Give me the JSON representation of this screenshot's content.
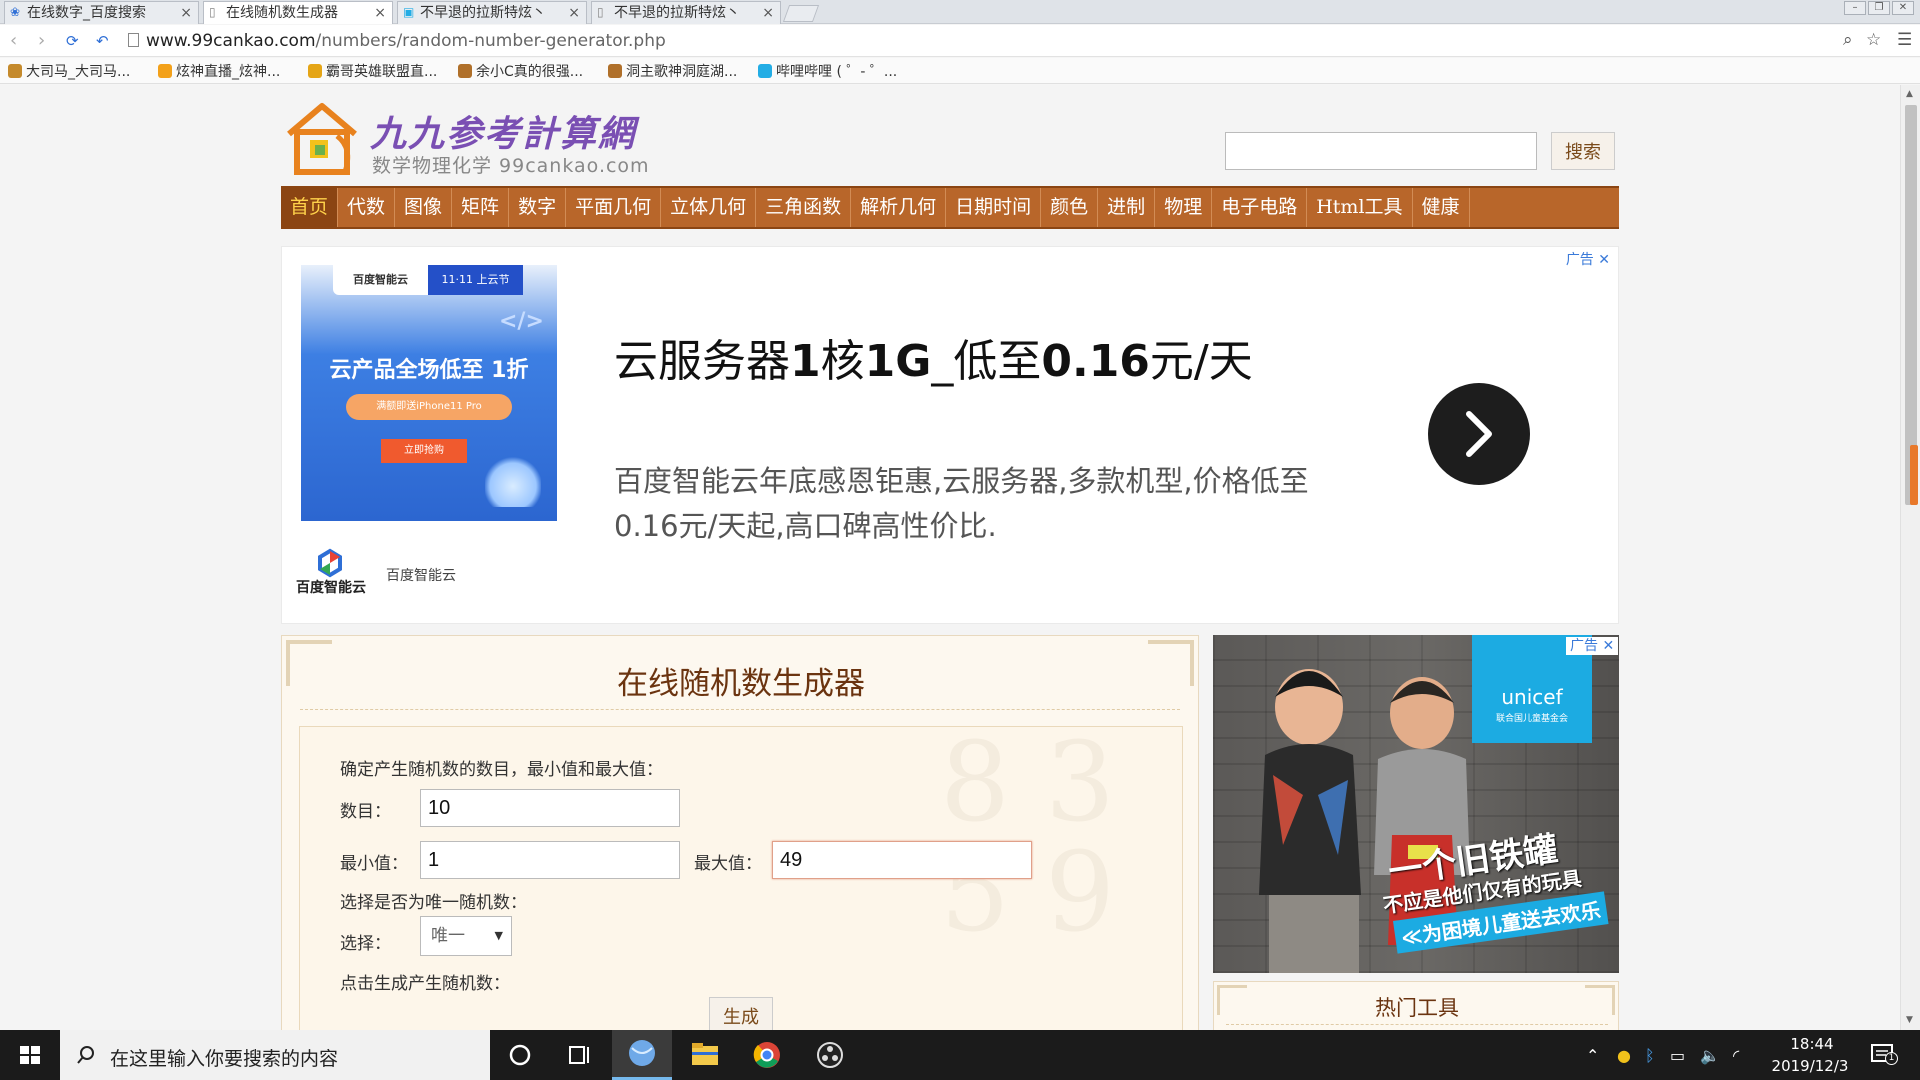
{
  "browser": {
    "tabs": [
      {
        "title": "在线数字_百度搜索",
        "active": false
      },
      {
        "title": "在线随机数生成器",
        "active": true
      },
      {
        "title": "不早退的拉斯特炫丶",
        "active": false
      },
      {
        "title": "不早退的拉斯特炫丶",
        "active": false
      }
    ],
    "close_glyph": "×",
    "url_host": "www.99cankao.com",
    "url_path": "/numbers/random-number-generator.php",
    "bookmarks": [
      {
        "label": "大司马_大司马...",
        "icon_color": "#c58a2c"
      },
      {
        "label": "炫神直播_炫神...",
        "icon_color": "#f3a11a"
      },
      {
        "label": "霸哥英雄联盟直...",
        "icon_color": "#e5a516"
      },
      {
        "label": "余小C真的很强...",
        "icon_color": "#b0702a"
      },
      {
        "label": "洞主歌神洞庭湖...",
        "icon_color": "#b0702a"
      },
      {
        "label": "哔哩哔哩 ( ゜- ゜...",
        "icon_color": "#23ade5"
      }
    ]
  },
  "site": {
    "logo_title": "九九参考計算網",
    "logo_sub": "数学物理化学 99cankao.com",
    "search_placeholder": "",
    "search_button": "搜索",
    "nav": [
      "首页",
      "代数",
      "图像",
      "矩阵",
      "数字",
      "平面几何",
      "立体几何",
      "三角函数",
      "解析几何",
      "日期时间",
      "颜色",
      "进制",
      "物理",
      "电子电路",
      "Html工具",
      "健康"
    ],
    "nav_active_index": 0,
    "brand_color": "#b8662a"
  },
  "ad": {
    "badge": "广告",
    "close_glyph": "✕",
    "image_top_left": "百度智能云",
    "image_top_right": "11·11 上云节",
    "image_headline": "云产品全场低至 1折",
    "image_pill": "满额即送iPhone11 Pro",
    "image_cta": "立即抢购",
    "image_code": "</>",
    "title_parts": [
      "云服务器",
      "1",
      "核",
      "1G",
      "_低至",
      "0.16",
      "元/天"
    ],
    "description": "百度智能云年底感恩钜惠,云服务器,多款机型,价格低至0.16元/天起,高口碑高性价比.",
    "brand_logo_text": "百度智能云",
    "brand_name": "百度智能云"
  },
  "generator": {
    "title": "在线随机数生成器",
    "intro": "确定产生随机数的数目，最小值和最大值：",
    "count_label": "数目：",
    "count_value": "10",
    "min_label": "最小值：",
    "min_value": "1",
    "max_label": "最大值：",
    "max_value": "49",
    "unique_prompt": "选择是否为唯一随机数：",
    "select_label": "选择：",
    "select_value": "唯一",
    "generate_prompt": "点击生成产生随机数：",
    "generate_button": "生成"
  },
  "side_ad": {
    "badge": "广告",
    "unicef": "unicef",
    "unicef_sub": "联合国儿童基金会",
    "line1": "一个旧铁罐",
    "line2": "不应是他们仅有的玩具",
    "line3": "≪为困境儿童送去欢乐"
  },
  "hot_tools": {
    "title": "热门工具"
  },
  "taskbar": {
    "search_placeholder": "在这里输入你要搜索的内容",
    "time": "18:44",
    "date": "2019/12/3",
    "notification_count": "1"
  }
}
